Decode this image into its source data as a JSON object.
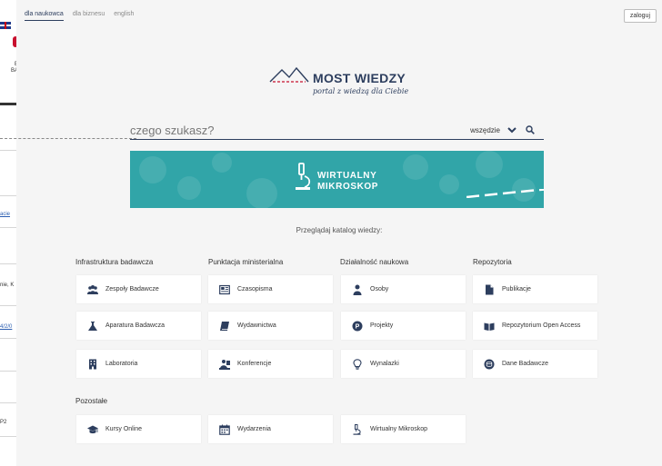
{
  "background_page": {
    "logo_text": "B\nBA",
    "snippets": [
      "acie",
      "nie, K",
      "4/2/0",
      "P2"
    ]
  },
  "nav": {
    "links": [
      "dla naukowca",
      "dla biznesu",
      "english"
    ],
    "active": "dla naukowca",
    "login_label": "zaloguj"
  },
  "brand": {
    "name": "MOST WIEDZY",
    "tagline": "portal z wiedzą dla Ciebie"
  },
  "search": {
    "placeholder": "czego szukasz?",
    "scope": "wszędzie"
  },
  "banner": {
    "line1": "WIRTUALNY",
    "line2": "MIKROSKOP"
  },
  "browse_label": "Przeglądaj katalog wiedzy:",
  "columns": [
    {
      "title": "Infrastruktura badawcza",
      "items": [
        {
          "label": "Zespoły Badawcze",
          "icon": "people-icon"
        },
        {
          "label": "Aparatura Badawcza",
          "icon": "flask-icon"
        },
        {
          "label": "Laboratoria",
          "icon": "building-icon"
        }
      ]
    },
    {
      "title": "Punktacja ministerialna",
      "items": [
        {
          "label": "Czasopisma",
          "icon": "newspaper-icon"
        },
        {
          "label": "Wydawnictwa",
          "icon": "book-icon"
        },
        {
          "label": "Konferencje",
          "icon": "presenter-icon"
        }
      ]
    },
    {
      "title": "Działalność naukowa",
      "items": [
        {
          "label": "Osoby",
          "icon": "person-icon"
        },
        {
          "label": "Projekty",
          "icon": "project-icon"
        },
        {
          "label": "Wynalazki",
          "icon": "lightbulb-icon"
        }
      ]
    },
    {
      "title": "Repozytoria",
      "items": [
        {
          "label": "Publikacje",
          "icon": "document-icon"
        },
        {
          "label": "Repozytorium Open Access",
          "icon": "open-book-icon"
        },
        {
          "label": "Dane Badawcze",
          "icon": "data-icon"
        }
      ]
    }
  ],
  "other": {
    "title": "Pozostałe",
    "items": [
      {
        "label": "Kursy Online",
        "icon": "graduation-cap-icon"
      },
      {
        "label": "Wydarzenia",
        "icon": "calendar-icon"
      },
      {
        "label": "Wirtualny Mikroskop",
        "icon": "microscope-icon"
      }
    ]
  },
  "colors": {
    "navy": "#2d3e5e",
    "teal": "#31a5a8",
    "panel": "#f5f5f5"
  }
}
